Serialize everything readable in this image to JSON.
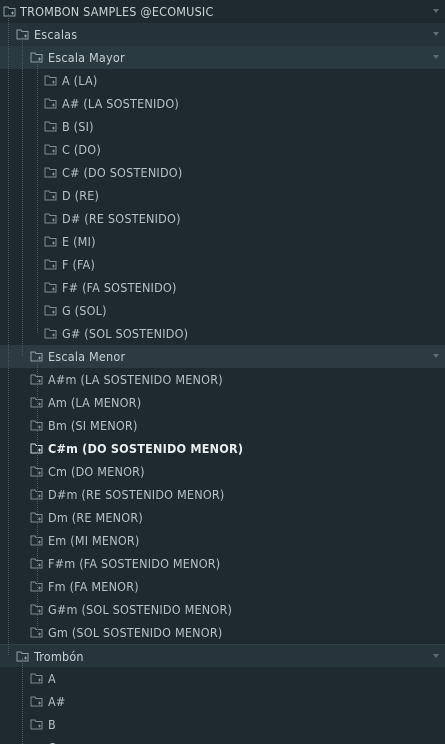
{
  "tree": {
    "root": {
      "label": "TROMBON SAMPLES @ECOMUSIC"
    },
    "escalas": {
      "label": "Escalas"
    },
    "mayor": {
      "label": "Escala Mayor",
      "items": [
        "A (LA)",
        "A# (LA SOSTENIDO)",
        "B (SI)",
        "C (DO)",
        "C# (DO SOSTENIDO)",
        "D (RE)",
        "D# (RE SOSTENIDO)",
        "E (MI)",
        "F (FA)",
        "F# (FA SOSTENIDO)",
        "G (SOL)",
        "G# (SOL SOSTENIDO)"
      ]
    },
    "menor": {
      "label": "Escala Menor",
      "items": [
        "A#m (LA SOSTENIDO MENOR)",
        "Am (LA MENOR)",
        "Bm (SI MENOR)",
        "C#m (DO SOSTENIDO MENOR)",
        "Cm (DO MENOR)",
        "D#m (RE SOSTENIDO MENOR)",
        "Dm (RE MENOR)",
        "Em (MI MENOR)",
        "F#m (FA SOSTENIDO MENOR)",
        "Fm (FA MENOR)",
        "G#m (SOL SOSTENIDO MENOR)",
        "Gm (SOL SOSTENIDO MENOR)"
      ],
      "selected_index": 3
    },
    "trombon": {
      "label": "Trombón",
      "items": [
        "A",
        "A#",
        "B",
        "C"
      ]
    }
  },
  "icons": {
    "folder": "folder-icon",
    "collapse": "chevron-down-icon"
  },
  "colors": {
    "background": "#1f2a30",
    "text": "#b6c2c6",
    "selected_text": "#e8eef0",
    "guide": "#4d5c62"
  }
}
